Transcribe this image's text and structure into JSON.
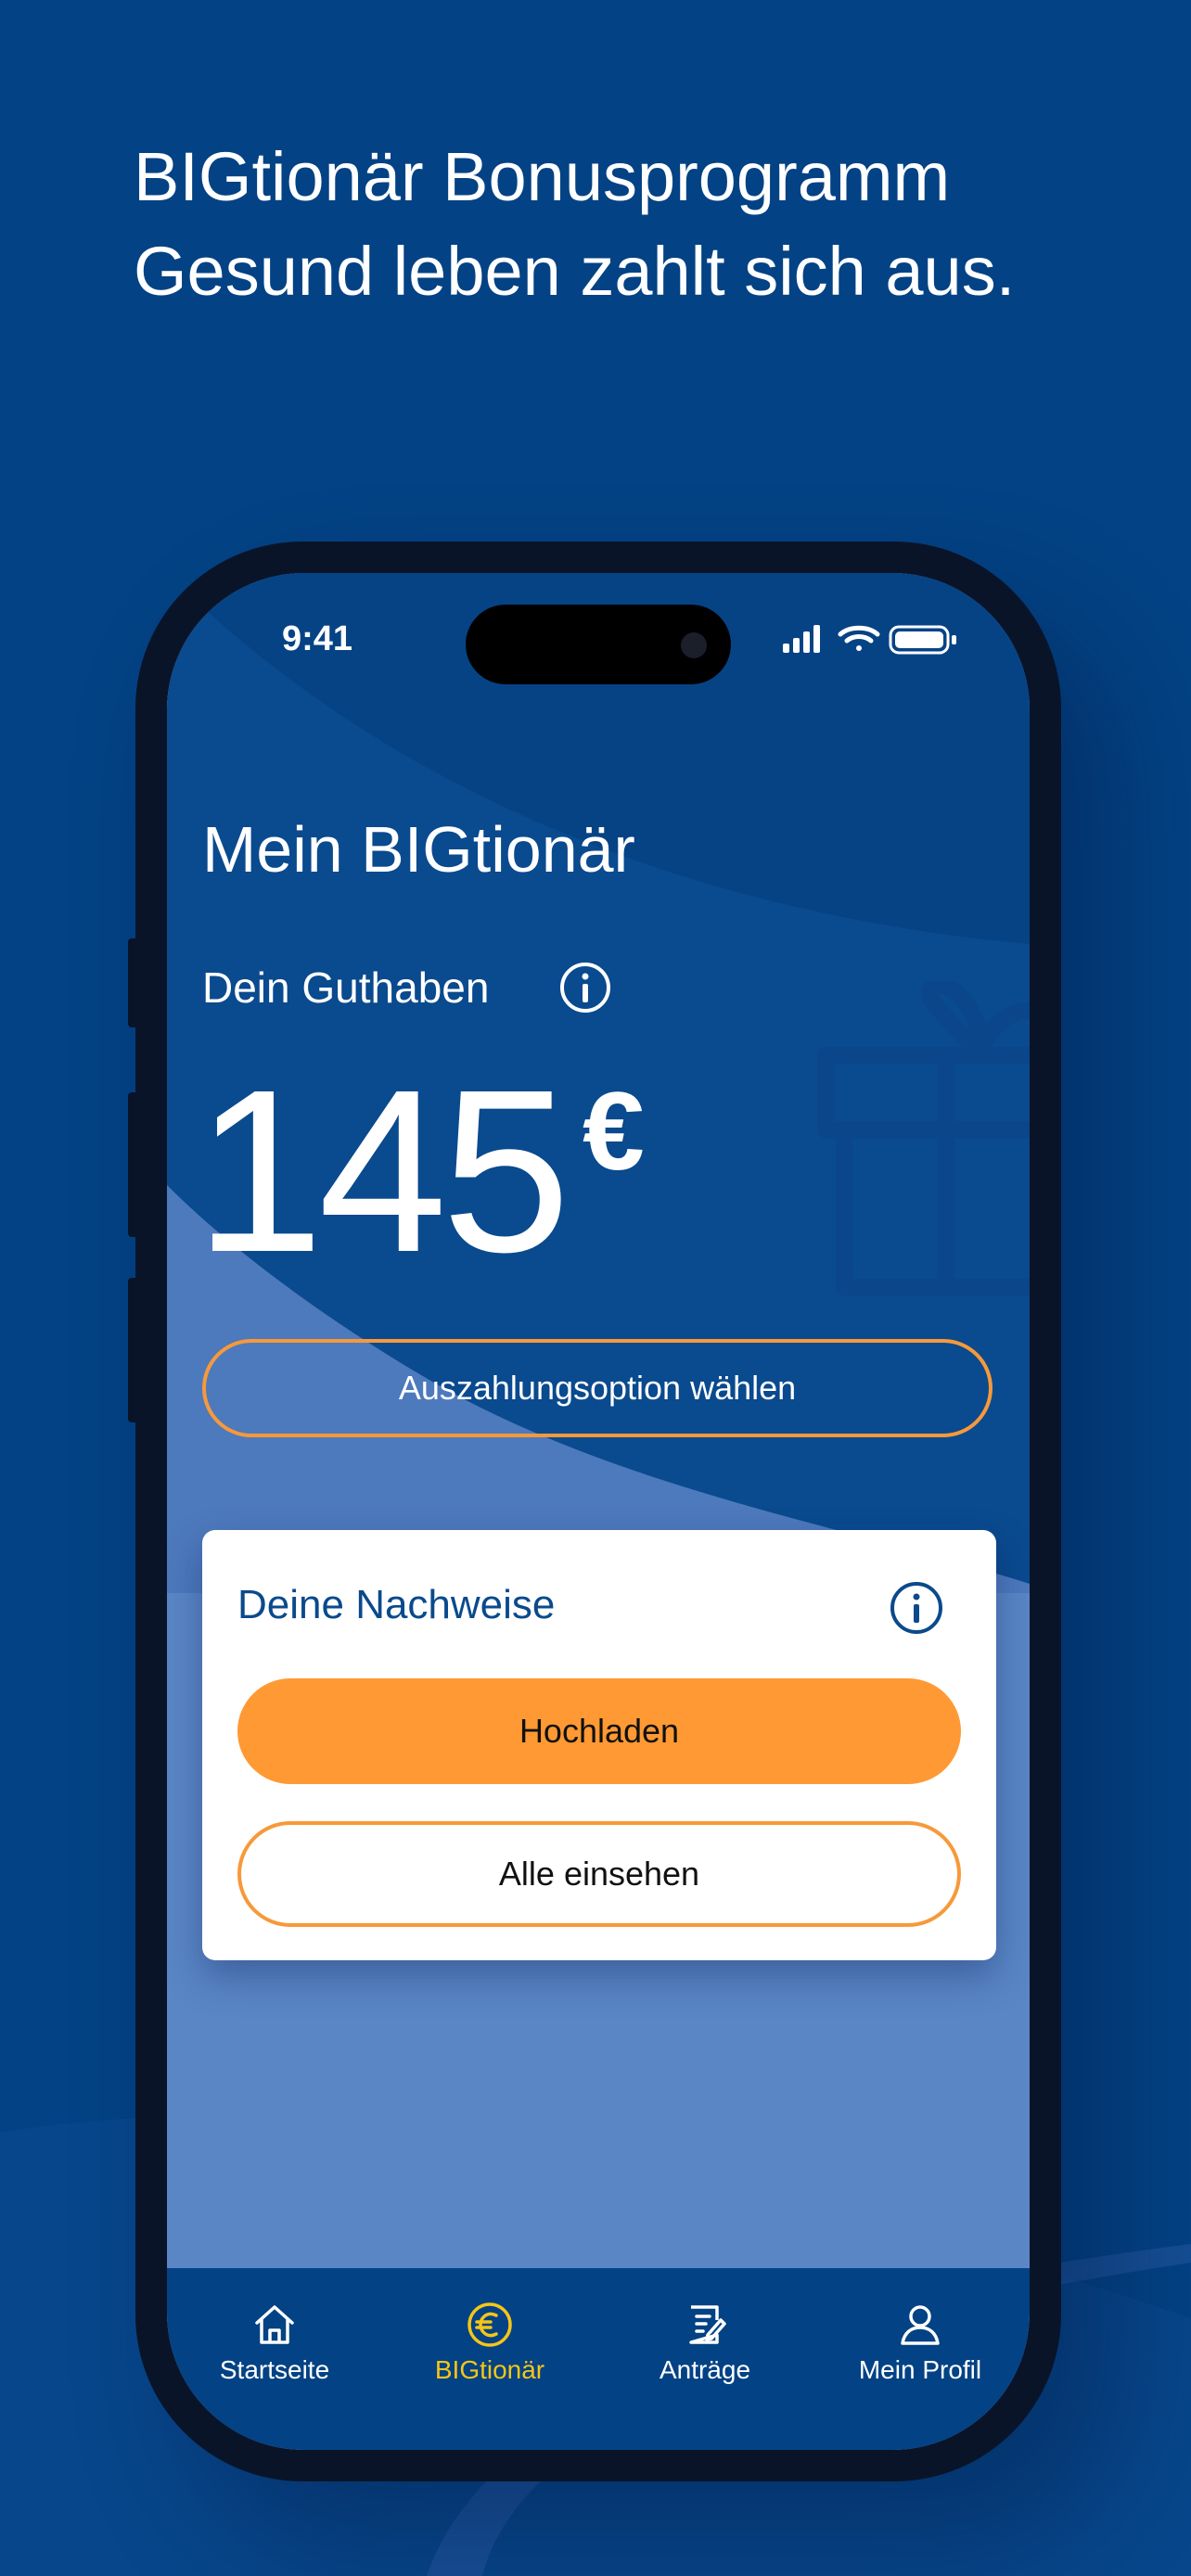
{
  "headline": {
    "line1": "BIGtionär Bonusprogramm",
    "line2": "Gesund leben zahlt sich aus."
  },
  "status_bar": {
    "time": "9:41",
    "icons": [
      "cellular-signal-icon",
      "wifi-icon",
      "battery-icon"
    ]
  },
  "page": {
    "title": "Mein BIGtionär",
    "balance_label": "Dein Guthaben",
    "balance_value": "145",
    "currency": "€",
    "payout_button": "Auszahlungsoption wählen"
  },
  "proofs_card": {
    "title": "Deine Nachweise",
    "upload_button": "Hochladen",
    "view_all_button": "Alle einsehen"
  },
  "tabbar": {
    "items": [
      {
        "label": "Startseite",
        "icon": "home-icon"
      },
      {
        "label": "BIGtionär",
        "icon": "euro-coin-icon",
        "active": true
      },
      {
        "label": "Anträge",
        "icon": "document-edit-icon"
      },
      {
        "label": "Mein Profil",
        "icon": "profile-icon"
      }
    ]
  },
  "colors": {
    "background": "#034284",
    "accent_orange": "#ff9933",
    "active_tab": "#f5c518",
    "card_title": "#0a4a8c"
  }
}
